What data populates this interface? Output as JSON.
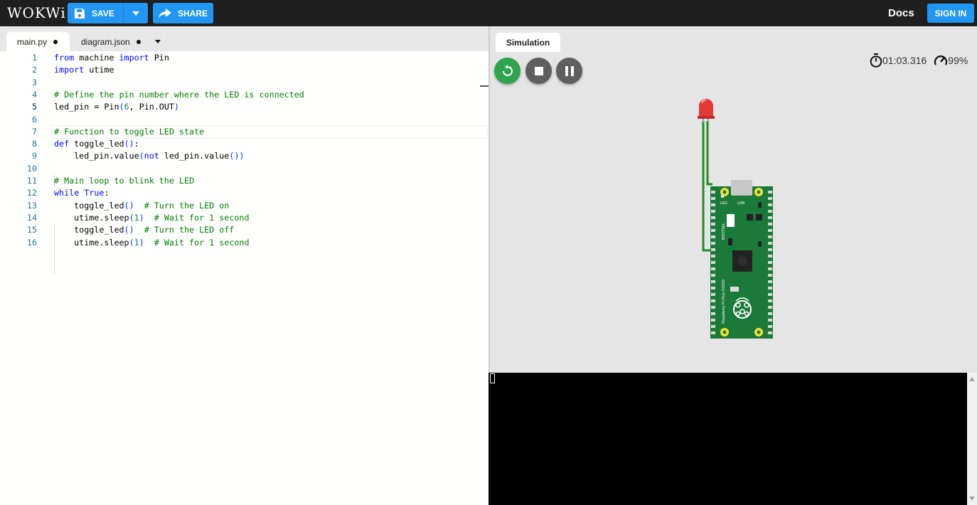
{
  "app": {
    "logo": "WOKWi"
  },
  "toolbar": {
    "save_label": "SAVE",
    "share_label": "SHARE",
    "docs_label": "Docs",
    "signin_label": "SIGN IN"
  },
  "editor": {
    "tabs": [
      {
        "label": "main.py",
        "modified": true
      },
      {
        "label": "diagram.json",
        "modified": true
      }
    ],
    "lines": [
      {
        "n": "1",
        "text": "from machine import Pin"
      },
      {
        "n": "2",
        "text": "import utime"
      },
      {
        "n": "3",
        "text": ""
      },
      {
        "n": "4",
        "text": "# Define the pin number where the LED is connected"
      },
      {
        "n": "5",
        "text": "led_pin = Pin(6, Pin.OUT)"
      },
      {
        "n": "6",
        "text": ""
      },
      {
        "n": "7",
        "text": "# Function to toggle LED state"
      },
      {
        "n": "8",
        "text": "def toggle_led():"
      },
      {
        "n": "9",
        "text": "    led_pin.value(not led_pin.value())"
      },
      {
        "n": "10",
        "text": ""
      },
      {
        "n": "11",
        "text": "# Main loop to blink the LED"
      },
      {
        "n": "12",
        "text": "while True:"
      },
      {
        "n": "13",
        "text": "    toggle_led()  # Turn the LED on"
      },
      {
        "n": "14",
        "text": "    utime.sleep(1)  # Wait for 1 second"
      },
      {
        "n": "15",
        "text": "    toggle_led()  # Turn the LED off"
      },
      {
        "n": "16",
        "text": "    utime.sleep(1)  # Wait for 1 second"
      }
    ]
  },
  "simulation": {
    "tab_label": "Simulation",
    "elapsed": "01:03.316",
    "speed": "99%",
    "board_labels": {
      "led": "LED",
      "usb": "USB",
      "bootsel": "BOOTSEL",
      "board_name": "Raspberry Pi Pico ©2020"
    }
  },
  "colors": {
    "accent": "#2196f3",
    "run_green": "#2ea44f",
    "pcb_green": "#1b7a3a",
    "wire_green": "#1f8a2a",
    "led_red": "#e53935"
  }
}
